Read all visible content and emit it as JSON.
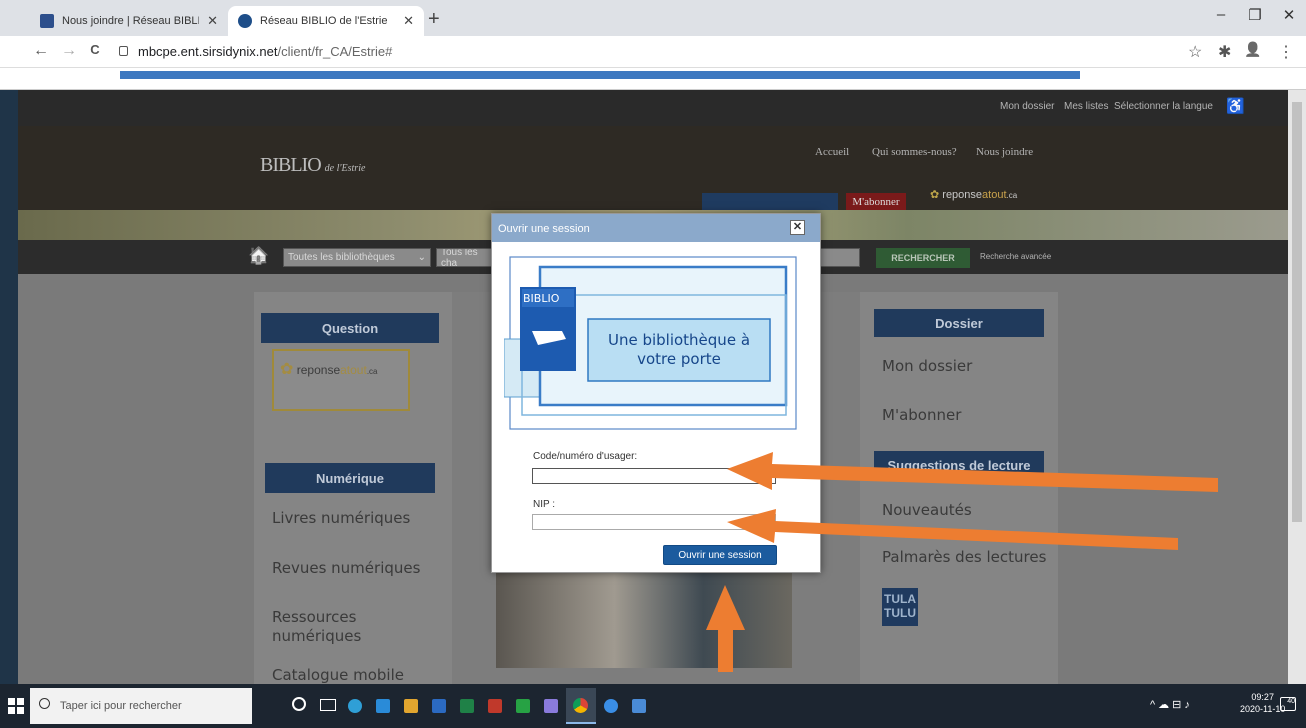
{
  "browser": {
    "tabs": [
      {
        "label": "Nous joindre | Réseau BIBLIO de l'Estrie",
        "close": "✕"
      },
      {
        "label": "Réseau BIBLIO de l'Estrie",
        "close": "✕"
      }
    ],
    "new_tab": "+",
    "window_controls": {
      "minimize": "–",
      "maximize": "❐",
      "close": "✕"
    },
    "nav": {
      "back": "←",
      "forward": "→",
      "reload": "C"
    },
    "url_host": "mbcpe.ent.sirsidynix.net",
    "url_path": "/client/fr_CA/Estrie#",
    "toolbar_icons": {
      "star": "☆",
      "extensions": "✱",
      "profile": "👤",
      "menu": "⋮"
    }
  },
  "site": {
    "top_links": [
      "Mon dossier",
      "Mes listes",
      "Sélectionner la langue"
    ],
    "accessibility": "♿",
    "brand": {
      "name": "BIBLIO",
      "suffix": "de l'Estrie"
    },
    "header_links": [
      "Accueil",
      "Qui sommes-nous?",
      "Nous joindre"
    ],
    "subscribe_button": "M'abonner",
    "reponse_logo": {
      "main": "reponse",
      "accent": "atout",
      "tld": ".ca"
    },
    "search": {
      "home_icon": "🏠",
      "library_select": "Toutes les bibliothèques",
      "field_select": "Tous les cha",
      "button": "RECHERCHER",
      "advanced": "Recherche avancée"
    },
    "left_cards": {
      "question_title": "Question",
      "numerique_title": "Numérique",
      "numerique_links": [
        "Livres numériques",
        "Revues numériques",
        "Ressources numériques",
        "Catalogue mobile"
      ]
    },
    "right_cards": {
      "dossier_title": "Dossier",
      "dossier_links": [
        "Mon dossier",
        "M'abonner"
      ],
      "suggestions_title": "Suggestions de lecture",
      "suggestions_links": [
        "Nouveautés",
        "Palmarès des lectures"
      ],
      "tulatulu": [
        "TULA",
        "TULU"
      ]
    }
  },
  "modal": {
    "title": "Ouvrir une session",
    "close": "✕",
    "logo_badge": "BIBLIO",
    "logo_text": "Une bibliothèque à votre porte",
    "user_label": "Code/numéro d'usager:",
    "user_value": "",
    "pin_label": "NIP :",
    "pin_value": "",
    "submit": "Ouvrir une session"
  },
  "taskbar": {
    "start_icon": "windows-icon",
    "search_placeholder": "Taper ici pour rechercher",
    "time": "09:27",
    "date": "2020-11-10",
    "notifications": "40"
  },
  "colors": {
    "modal_header": "#8ba9cb",
    "login_button": "#1b5b9e",
    "annotation_arrow": "#ed7d31",
    "url_bar_highlight": "#3d78c0"
  }
}
